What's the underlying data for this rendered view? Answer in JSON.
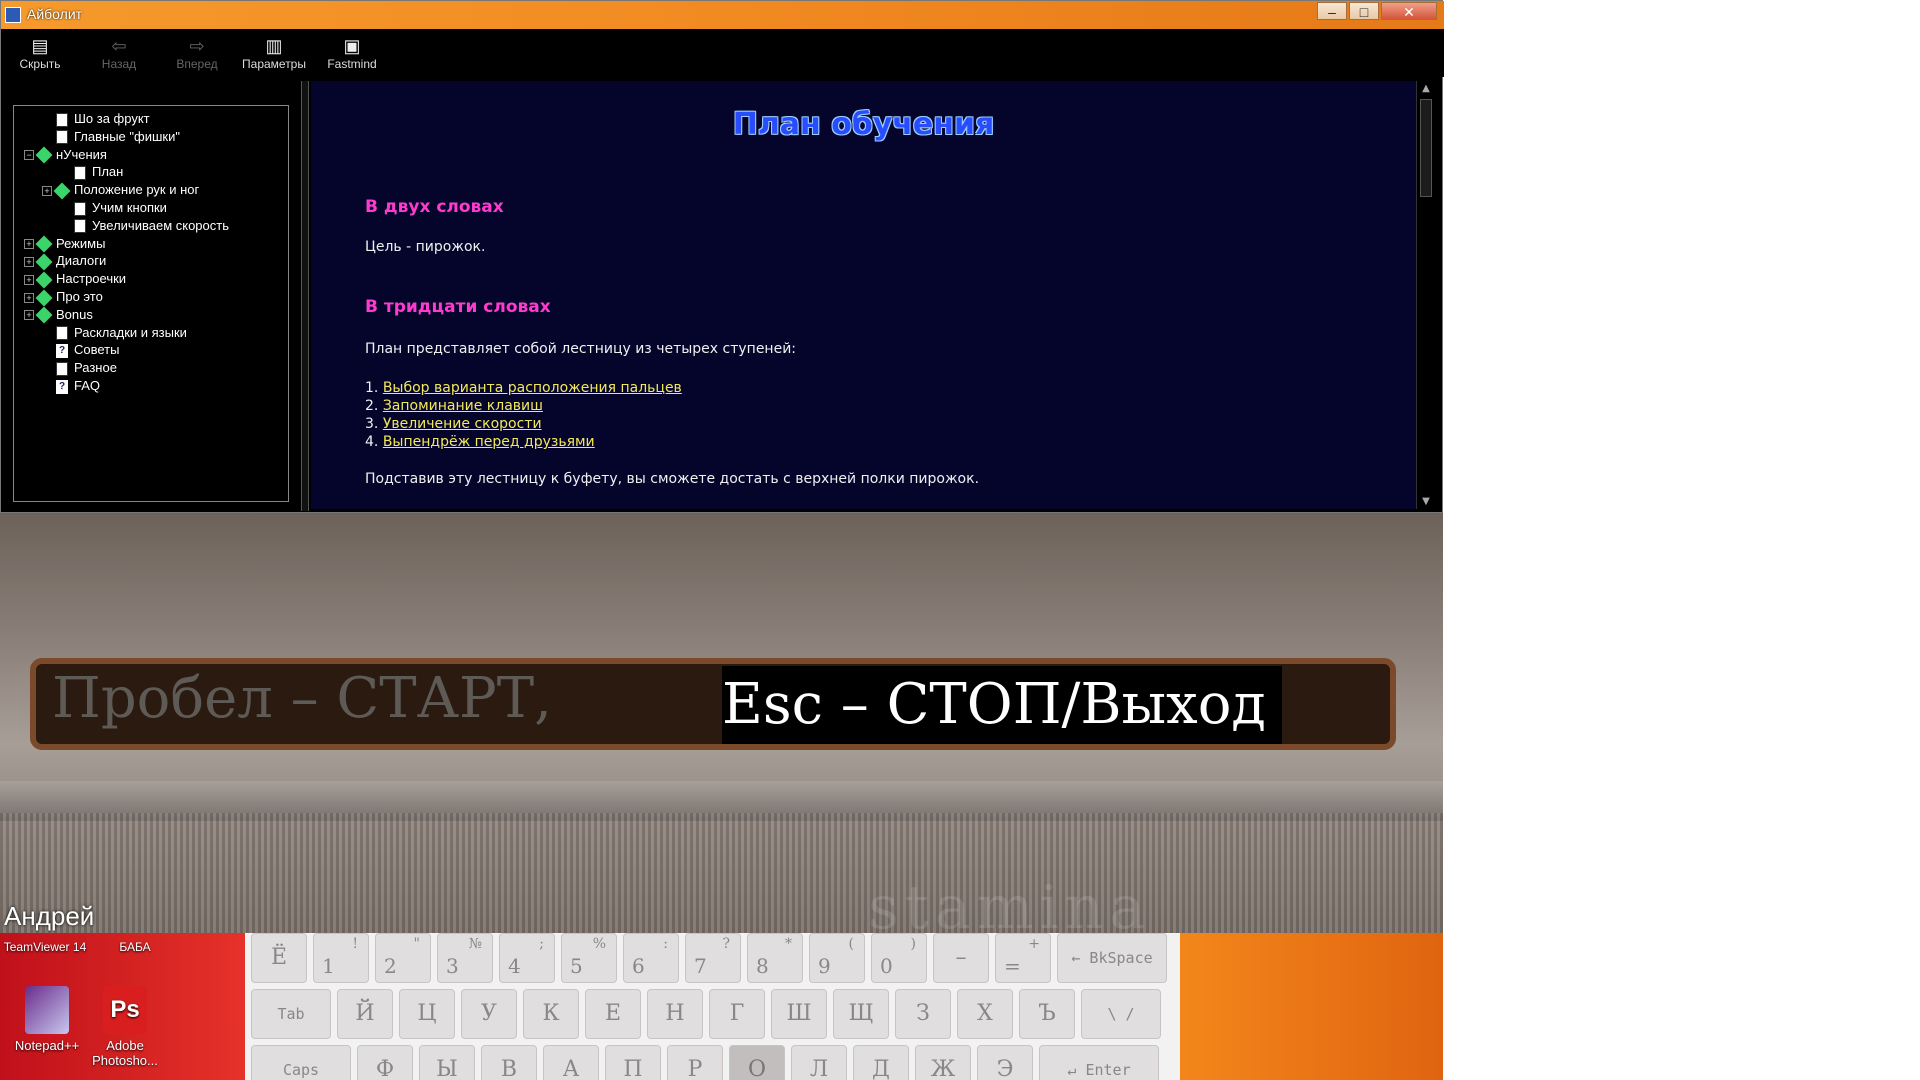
{
  "window": {
    "title": "Айболит",
    "controls": {
      "minimize": "–",
      "maximize": "□",
      "close": "✕"
    }
  },
  "toolbar": {
    "hide": {
      "label": "Скрыть",
      "icon": "hide-icon",
      "glyph": "▤"
    },
    "back": {
      "label": "Назад",
      "icon": "back-arrow-icon",
      "glyph": "⇦"
    },
    "forward": {
      "label": "Вперед",
      "icon": "forward-arrow-icon",
      "glyph": "⇨"
    },
    "options": {
      "label": "Параметры",
      "icon": "options-icon",
      "glyph": "▥"
    },
    "fastmind": {
      "label": "Fastmind",
      "icon": "fastmind-icon",
      "glyph": "▣"
    }
  },
  "tree": {
    "items": [
      {
        "label": "Шо за фрукт",
        "icon": "page-icon",
        "level": 1,
        "expander": ""
      },
      {
        "label": "Главные \"фишки\"",
        "icon": "page-icon",
        "level": 1,
        "expander": ""
      },
      {
        "label": "нУчения",
        "icon": "open-book-icon",
        "level": 0,
        "expander": "−"
      },
      {
        "label": "План",
        "icon": "page-icon",
        "level": 2,
        "expander": ""
      },
      {
        "label": "Положение рук и ног",
        "icon": "book-icon",
        "level": 1,
        "expander": "+"
      },
      {
        "label": "Учим кнопки",
        "icon": "page-icon",
        "level": 2,
        "expander": ""
      },
      {
        "label": "Увеличиваем скорость",
        "icon": "page-icon",
        "level": 2,
        "expander": ""
      },
      {
        "label": "Режимы",
        "icon": "book-icon",
        "level": 0,
        "expander": "+"
      },
      {
        "label": "Диалоги",
        "icon": "book-icon",
        "level": 0,
        "expander": "+"
      },
      {
        "label": "Настроечки",
        "icon": "book-icon",
        "level": 0,
        "expander": "+"
      },
      {
        "label": "Про это",
        "icon": "book-icon",
        "level": 0,
        "expander": "+"
      },
      {
        "label": "Bonus",
        "icon": "book-icon",
        "level": 0,
        "expander": "+"
      },
      {
        "label": "Раскладки и языки",
        "icon": "page-icon",
        "level": 1,
        "expander": ""
      },
      {
        "label": "Советы",
        "icon": "help-icon",
        "level": 1,
        "expander": ""
      },
      {
        "label": "Разное",
        "icon": "page-icon",
        "level": 1,
        "expander": ""
      },
      {
        "label": "FAQ",
        "icon": "help-icon",
        "level": 1,
        "expander": ""
      }
    ]
  },
  "content": {
    "title": "План обучения",
    "section1_heading": "В двух словах",
    "section1_text": "Цель - пирожок.",
    "section2_heading": "В тридцати словах",
    "section2_text": "План представляет собой лестницу из четырех ступеней:",
    "steps": [
      {
        "num": "1.",
        "link": "Выбор варианта расположения пальцев"
      },
      {
        "num": "2.",
        "link": "Запоминание клавиш"
      },
      {
        "num": "3.",
        "link": "Увеличение скорости"
      },
      {
        "num": "4.",
        "link": "Выпендрёж перед друзьями"
      }
    ],
    "closing_text": "Подставив эту лестницу к буфету, вы сможете достать с верхней полки пирожок."
  },
  "trainer": {
    "typed_text": "Пробел – СТАРТ, ",
    "pending_text": "Esc – СТОП/Выход",
    "user_name": "Андрей",
    "watermark": "stamina"
  },
  "desktop": {
    "icons": [
      {
        "label": "TeamViewer 14",
        "icon": "teamviewer-icon"
      },
      {
        "label": "БАБА",
        "icon": "folder-icon"
      },
      {
        "label": "Notepad++",
        "icon": "notepad-plus-plus-icon"
      },
      {
        "label": "Adobe Photosho...",
        "icon": "photoshop-icon",
        "glyph": "Ps"
      }
    ]
  },
  "keyboard": {
    "row1": [
      {
        "lo": "Ё",
        "hi": ""
      },
      {
        "lo": "1",
        "hi": "!"
      },
      {
        "lo": "2",
        "hi": "\""
      },
      {
        "lo": "3",
        "hi": "№"
      },
      {
        "lo": "4",
        "hi": ";"
      },
      {
        "lo": "5",
        "hi": "%"
      },
      {
        "lo": "6",
        "hi": ":"
      },
      {
        "lo": "7",
        "hi": "?"
      },
      {
        "lo": "8",
        "hi": "*"
      },
      {
        "lo": "9",
        "hi": "("
      },
      {
        "lo": "0",
        "hi": ")"
      },
      {
        "lo": "–",
        "hi": ""
      },
      {
        "lo": "=",
        "hi": "+"
      },
      {
        "lo": "← BkSpace",
        "hi": ""
      }
    ],
    "row2": [
      "Tab",
      "Й",
      "Ц",
      "У",
      "К",
      "Е",
      "Н",
      "Г",
      "Ш",
      "Щ",
      "З",
      "Х",
      "Ъ",
      "\\ /"
    ],
    "row3": [
      "Caps",
      "Ф",
      "Ы",
      "В",
      "А",
      "П",
      "Р",
      "О",
      "Л",
      "Д",
      "Ж",
      "Э",
      "↵ Enter"
    ]
  },
  "colors": {
    "content_bg": "#05052c",
    "heading": "#ff3acf",
    "link": "#f2e85c",
    "title": "#2a4cff"
  }
}
